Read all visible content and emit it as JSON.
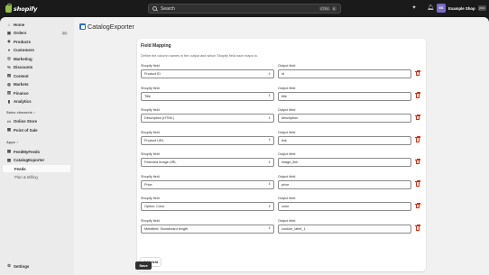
{
  "topbar": {
    "logo_text": "shopify",
    "search_placeholder": "Search",
    "shortcut_keys": [
      "CTRL",
      "K"
    ],
    "user": {
      "initials": "ES",
      "shop_name": "Example Shop",
      "badge": "plus"
    }
  },
  "sidebar": {
    "items": [
      {
        "label": "Home",
        "icon": "home-icon"
      },
      {
        "label": "Orders",
        "icon": "orders-icon",
        "count": "10"
      },
      {
        "label": "Products",
        "icon": "products-icon"
      },
      {
        "label": "Customers",
        "icon": "customers-icon"
      },
      {
        "label": "Marketing",
        "icon": "marketing-icon"
      },
      {
        "label": "Discounts",
        "icon": "discounts-icon"
      },
      {
        "label": "Content",
        "icon": "content-icon"
      },
      {
        "label": "Markets",
        "icon": "markets-icon"
      },
      {
        "label": "Finance",
        "icon": "finance-icon"
      },
      {
        "label": "Analytics",
        "icon": "analytics-icon"
      }
    ],
    "sales_channels_label": "Sales channels",
    "channels": [
      {
        "label": "Online Store"
      },
      {
        "label": "Point of Sale"
      }
    ],
    "apps_label": "Apps",
    "apps": [
      {
        "label": "FeedMyFeeds"
      },
      {
        "label": "CatalogExporter"
      }
    ],
    "subitems": [
      {
        "label": "Feeds"
      },
      {
        "label": "Plan & Billing"
      }
    ],
    "settings_label": "Settings"
  },
  "main": {
    "app_title": "CatalogExporter",
    "card": {
      "title": "Field Mapping",
      "description": "Define the column names in the output and which Shopify field each maps to.",
      "shopify_field_label": "Shopify field",
      "output_field_label": "Output field",
      "mappings": [
        {
          "shopify": "Product ID",
          "output": "id"
        },
        {
          "shopify": "Title",
          "output": "title"
        },
        {
          "shopify": "Description (HTML)",
          "output": "description"
        },
        {
          "shopify": "Product URL",
          "output": "link"
        },
        {
          "shopify": "Featured Image URL",
          "output": "image_link"
        },
        {
          "shopify": "Price",
          "output": "price"
        },
        {
          "shopify": "Option: Color",
          "output": "color"
        },
        {
          "shopify": "Metafield: Snowboard length",
          "output": "custom_label_1"
        }
      ],
      "add_field_label": "Add field"
    },
    "save_label": "Save"
  },
  "colors": {
    "topbar": "#1a1a1a",
    "sidebar": "#ebebeb",
    "main_bg": "#f1f1f1",
    "danger": "#d72c0d",
    "primary_button": "#303030",
    "avatar": "#7b6bc7",
    "brand_green": "#95bf47"
  }
}
